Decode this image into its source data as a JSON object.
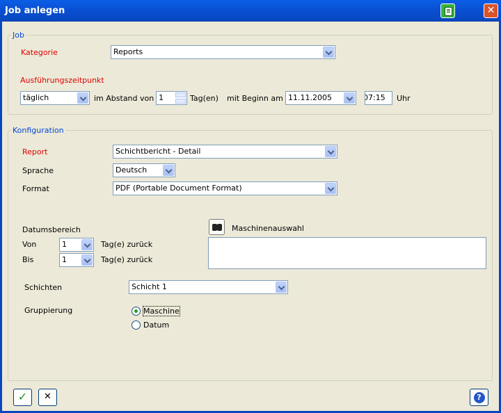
{
  "window": {
    "title": "Job anlegen"
  },
  "job": {
    "legend": "Job",
    "kategorie_label": "Kategorie",
    "kategorie_value": "Reports",
    "ausfuehrung_label": "Ausführungszeitpunkt",
    "interval_value": "täglich",
    "abstand_label": "im Abstand von",
    "abstand_value": "1",
    "tage_label": "Tag(en)",
    "beginn_label": "mit Beginn am",
    "beginn_date": "11.11.2005",
    "beginn_time": "07:15",
    "uhr_label": "Uhr"
  },
  "konfiguration": {
    "legend": "Konfiguration",
    "report_label": "Report",
    "report_value": "Schichtbericht - Detail",
    "sprache_label": "Sprache",
    "sprache_value": "Deutsch",
    "format_label": "Format",
    "format_value": "PDF (Portable Document Format)",
    "datumsbereich_label": "Datumsbereich",
    "von_label": "Von",
    "von_value": "1",
    "von_suffix": "Tag(e) zurück",
    "bis_label": "Bis",
    "bis_value": "1",
    "bis_suffix": "Tag(e) zurück",
    "maschinenauswahl_label": "Maschinenauswahl",
    "schichten_label": "Schichten",
    "schichten_value": "Schicht 1",
    "gruppierung_label": "Gruppierung",
    "gruppierung_options": [
      "Maschine",
      "Datum"
    ],
    "gruppierung_selected": "Maschine"
  },
  "footer": {
    "ok_glyph": "✓",
    "cancel_glyph": "✕",
    "help_glyph": "?"
  },
  "colors": {
    "titlebar": "#0a4fd2",
    "legend": "#0046d5",
    "required_label": "#e00000",
    "background": "#ece9d8"
  }
}
